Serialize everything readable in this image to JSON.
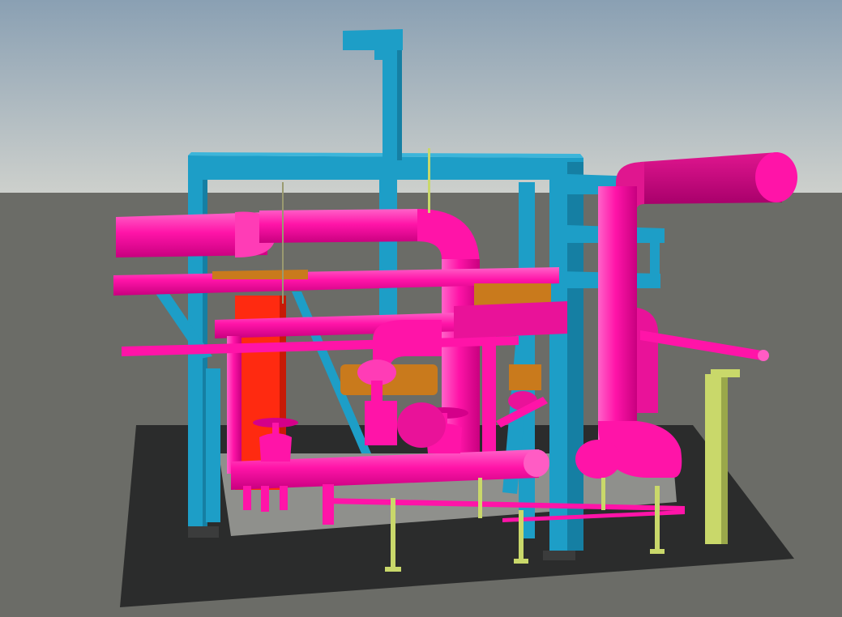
{
  "viewport": {
    "sky_top": "#8fa3b4",
    "sky_bottom": "#c9ccc9",
    "ground": "#6b6c67"
  },
  "scene": {
    "description_colors": {
      "steel": "#1d9ec7",
      "steel_dark": "#157fa3",
      "pipe": "#ff14a8",
      "pipe_dark": "#d4008a",
      "pipe_light": "#ff5cc4",
      "vessel": "#ff2a10",
      "equipment": "#c97a1c",
      "support": "#c9d86a",
      "slab": "#2a2b2b",
      "plinth": "#9a9b98"
    }
  }
}
